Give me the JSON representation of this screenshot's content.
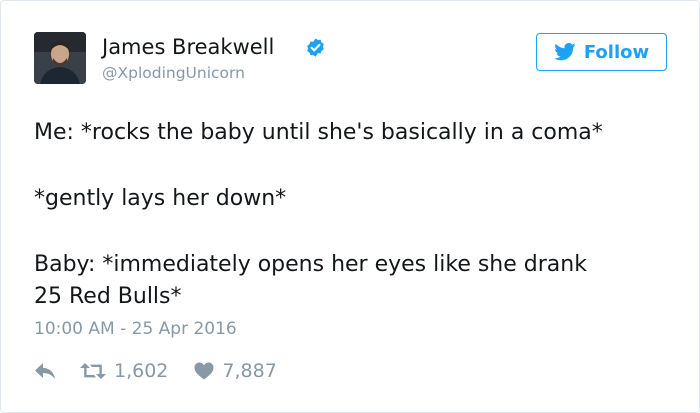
{
  "author": {
    "name": "James Breakwell",
    "handle": "@XplodingUnicorn",
    "verified": true
  },
  "follow_button": {
    "label": "Follow",
    "icon": "twitter-bird-icon"
  },
  "tweet": {
    "paragraphs": [
      "Me: *rocks the baby until she's basically in a coma*",
      "*gently lays her down*",
      "Baby: *immediately opens her eyes like she drank",
      "25 Red Bulls*"
    ],
    "timestamp": "10:00 AM - 25 Apr 2016"
  },
  "actions": {
    "reply_icon": "reply-arrow-icon",
    "retweet_icon": "retweet-icon",
    "retweet_count": "1,602",
    "like_icon": "heart-icon",
    "like_count": "7,887"
  },
  "colors": {
    "accent": "#1da1f2",
    "secondary_text": "#8899a6",
    "primary_text": "#14171a",
    "border": "#e1e8ed"
  }
}
